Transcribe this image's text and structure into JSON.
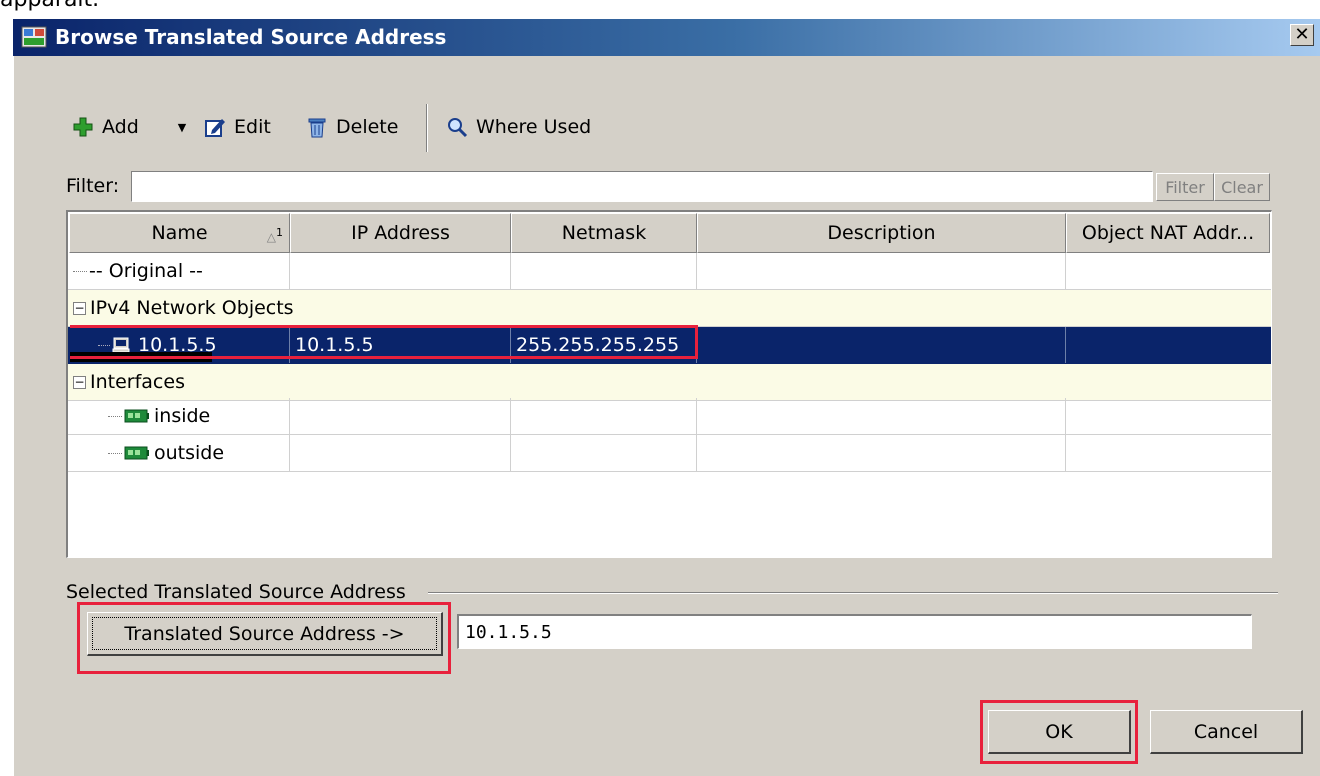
{
  "top_text": "apparait.",
  "window": {
    "title": "Browse Translated Source Address",
    "close_label": "✕"
  },
  "toolbar": {
    "add": "Add",
    "edit": "Edit",
    "delete": "Delete",
    "where_used": "Where Used"
  },
  "filter": {
    "label": "Filter:",
    "value": "",
    "filter_btn": "Filter",
    "clear_btn": "Clear"
  },
  "table": {
    "columns": [
      "Name",
      "IP Address",
      "Netmask",
      "Description",
      "Object NAT Addr..."
    ],
    "sort_indicator": "1",
    "rows": [
      {
        "name": "-- Original --",
        "ip": "",
        "netmask": "",
        "description": "",
        "object_nat": ""
      },
      {
        "group": "IPv4 Network Objects",
        "toggle": "−"
      },
      {
        "name": "10.1.5.5",
        "ip": "10.1.5.5",
        "netmask": "255.255.255.255",
        "description": "",
        "object_nat": ""
      },
      {
        "group": "Interfaces",
        "toggle": "−"
      },
      {
        "name": "inside",
        "ip": "",
        "netmask": "",
        "description": "",
        "object_nat": ""
      },
      {
        "name": "outside",
        "ip": "",
        "netmask": "",
        "description": "",
        "object_nat": ""
      }
    ]
  },
  "selection": {
    "section_label": "Selected Translated Source Address",
    "button_label": "Translated Source Address ->",
    "value": "10.1.5.5"
  },
  "footer": {
    "ok": "OK",
    "cancel": "Cancel"
  },
  "colors": {
    "title_gradient_start": "#0a246a",
    "selection": "#0a246a",
    "highlight": "#e8213c",
    "add_icon": "#2e9e2e"
  }
}
